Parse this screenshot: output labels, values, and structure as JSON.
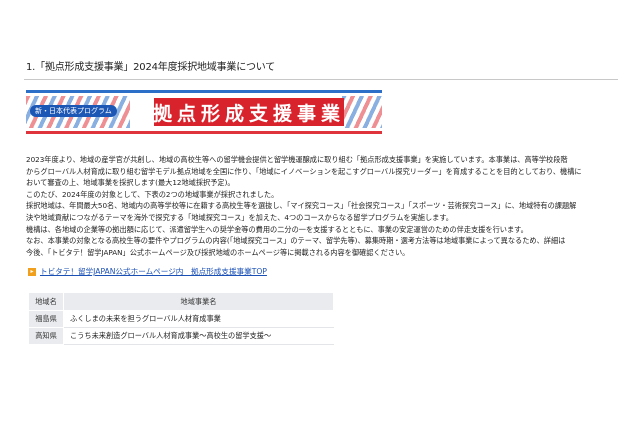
{
  "heading": "1.「拠点形成支援事業」2024年度採択地域事業について",
  "banner": {
    "tag": "新・日本代表プログラム",
    "title": "拠点形成支援事業"
  },
  "body": [
    "2023年度より、地域の産学官が共創し、地域の高校生等への留学機会提供と留学機運醸成に取り組む「拠点形成支援事業」を実施しています。本事業は、高等学校段階",
    "からグローバル人材育成に取り組む留学モデル拠点地域を全国に作り、「地域にイノベーションを起こすグローバル探究リーダー」を育成することを目的としており、機構に",
    "おいて審査の上、地域事業を採択します(最大12地域採択予定)。",
    "このたび、2024年度の対象として、下表の2つの地域事業が採択されました。",
    "採択地域は、年間最大50名、地域内の高等学校等に在籍する高校生等を選抜し、「マイ探究コース」「社会探究コース」「スポーツ・芸術探究コース」に、地域特有の課題解",
    "決や地域貢献につながるテーマを海外で探究する「地域探究コース」を加えた、4つのコースからなる留学プログラムを実施します。",
    "機構は、各地域の企業等の拠出額に応じて、派遣留学生への奨学金等の費用の二分の一を支援するとともに、事業の安定運営のための伴走支援を行います。",
    "なお、本事業の対象となる高校生等の要件やプログラムの内容(「地域探究コース」のテーマ、留学先等)、募集時期・選考方法等は地域事業によって異なるため、詳細は",
    "今後、「トビタテ！留学JAPAN」公式ホームページ及び採択地域のホームページ等に掲載される内容を御確認ください。"
  ],
  "link": {
    "icon": "external-link-icon",
    "text": "トビタテ！留学JAPAN公式ホームページ内　拠点形成支援事業TOP"
  },
  "table": {
    "headers": [
      "地域名",
      "地域事業名"
    ],
    "rows": [
      [
        "福島県",
        "ふくしまの未来を担うグローバル人材育成事業"
      ],
      [
        "高知県",
        "こうち未来創造グローバル人材育成事業～高校生の留学支援～"
      ]
    ]
  },
  "colors": {
    "accent_red": "#d9232c",
    "accent_blue": "#2b6fc9",
    "link": "#1a4fb4",
    "table_header": "#e9ebee"
  }
}
